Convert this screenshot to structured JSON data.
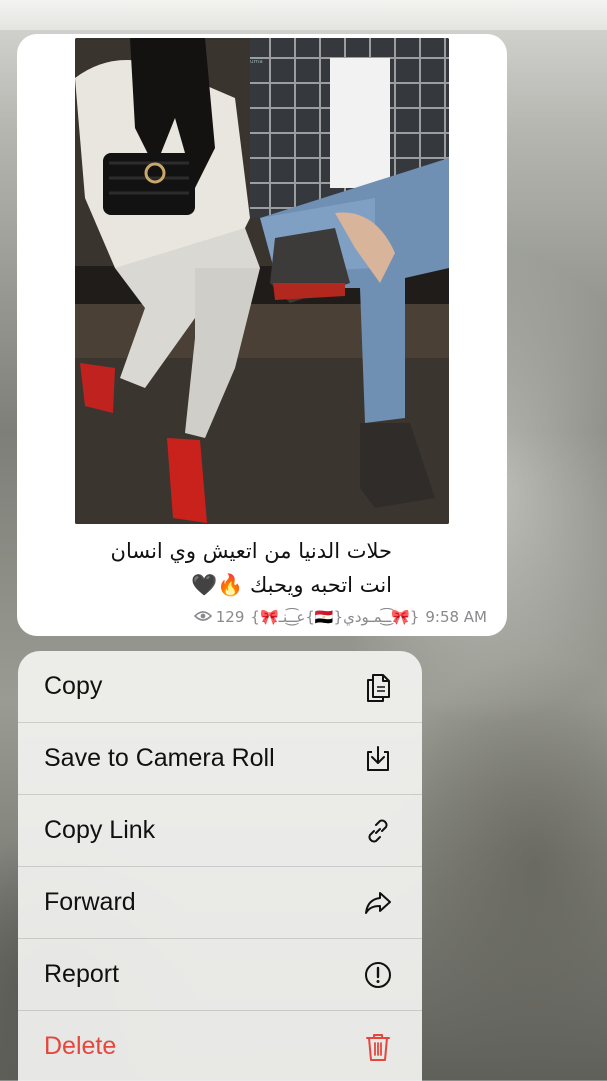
{
  "message": {
    "caption_lines": [
      "حلات الدنيا من اتعيش وي انسان",
      "انت اتحبه ويحبك 🔥🖤"
    ],
    "views": "129",
    "author": "{🎀عـ͜͡ـنـ{🇪🇬}ـ͜͡ـمـودي🎀}",
    "time": "9:58 AM",
    "photo_alt": "couple-sitting-photo"
  },
  "menu": {
    "items": [
      {
        "label": "Copy",
        "icon": "copy-icon"
      },
      {
        "label": "Save to Camera Roll",
        "icon": "save-download-icon"
      },
      {
        "label": "Copy Link",
        "icon": "link-icon"
      },
      {
        "label": "Forward",
        "icon": "forward-arrow-icon"
      },
      {
        "label": "Report",
        "icon": "exclamation-circle-icon"
      },
      {
        "label": "Delete",
        "icon": "trash-icon",
        "destructive": true
      }
    ]
  },
  "colors": {
    "destructive": "#e5473f",
    "bubble": "#ffffff",
    "menu_background": "#f2f2f0"
  }
}
